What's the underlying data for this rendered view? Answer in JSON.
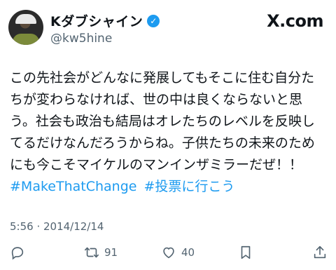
{
  "author": {
    "display_name": "Kダブシャイン",
    "handle": "@kw5hine",
    "verified_icon": "verified-badge-icon"
  },
  "brand": "X.com",
  "tweet": {
    "text": "この先社会がどんなに発展してもそこに住む自分た\nちが変わらなければ、世の中は良くならないと思\nう。社会も政治も結局はオレたちのレベルを反映し\nてるだけなんだろうからね。子供たちの未来のため\nにも今こそマイケルのマンインザミラーだぜ！！",
    "hashtags": [
      "#MakeThatChange",
      "#投票に行こう"
    ],
    "timestamp": "5:56 · 2014/12/14"
  },
  "actions": {
    "reply_icon": "reply-icon",
    "retweet_icon": "retweet-icon",
    "retweet_count": "91",
    "like_icon": "like-icon",
    "like_count": "40",
    "bookmark_icon": "bookmark-icon",
    "share_icon": "share-icon"
  },
  "colors": {
    "accent": "#1d9bf0",
    "muted": "#536471",
    "text": "#0f1419"
  }
}
